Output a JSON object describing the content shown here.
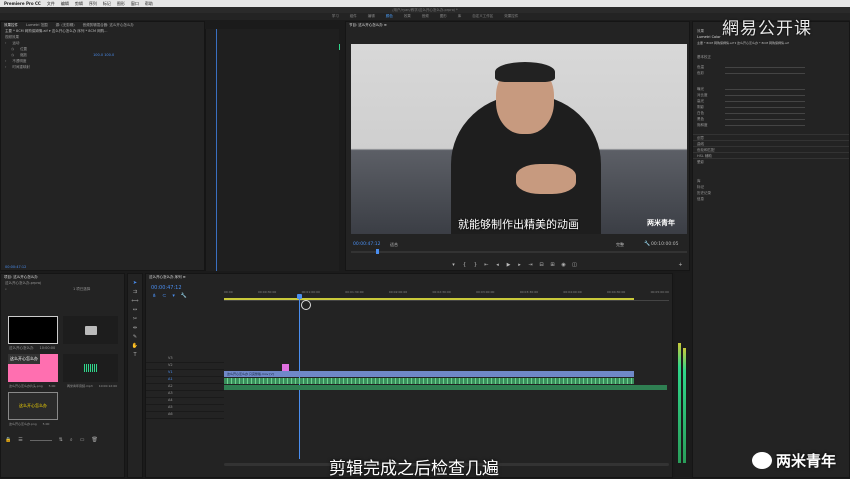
{
  "menubar": {
    "app": "Premiere Pro CC",
    "items": [
      "文件",
      "编辑",
      "剪辑",
      "序列",
      "标记",
      "图形",
      "窗口",
      "帮助"
    ]
  },
  "window_title": "/用户/ryan/教学/这么开心怎么办.prproj *",
  "workspaces": [
    "学习",
    "组件",
    "编辑",
    "颜色",
    "效果",
    "音频",
    "图形",
    "库",
    "自定义工作区",
    "效果控件"
  ],
  "workspace_active": "颜色",
  "left_panel": {
    "tabs": [
      "效果控件",
      "Lumetri 范围",
      "源: (无剪辑)",
      "音频剪辑混合器: 这么开心怎么办"
    ],
    "clip_path": "主要 * 8CM 网购保姆情.aif ▾  这么开心怎么办 序列 * 8CM 网购...",
    "section": "视频效果",
    "rows": [
      {
        "label": "运动",
        "value": ""
      },
      {
        "label": "位置",
        "value": ""
      },
      {
        "label": "缩放",
        "value": "100.0 100.0"
      },
      {
        "label": "不透明度",
        "value": ""
      },
      {
        "label": "时间重映射",
        "value": ""
      }
    ],
    "timecode": "00:00:47:12"
  },
  "effect_clip_label": "8CM 网购保姆情.aif",
  "program_monitor": {
    "title": "节目: 这么开心怎么办 ≡",
    "subtitle": "就能够制作出精美的动画",
    "timecode_in": "00:00:47:12",
    "fit": "适合",
    "quality": "完整",
    "timecode_out": "00:10:00:05",
    "brand_watermark": "两米青年"
  },
  "top_watermark": "網易公开课",
  "project_panel": {
    "title": "项目: 这么开心怎么办",
    "file": "这么开心怎么办.prproj",
    "count": "1 项已选择",
    "items": [
      {
        "name": "这么开心怎么办",
        "dur": "10:00:00"
      },
      {
        "name": "",
        "dur": ""
      },
      {
        "name": "这么开心怎么办片头.png",
        "dur": "5:00"
      },
      {
        "name": "两米青年音频.mp3",
        "dur": "10:00:12:00"
      },
      {
        "name": "这么开心怎么办.png",
        "dur": "5:00"
      }
    ],
    "thumb_text1": "这么开心怎么办",
    "thumb_text2": "这么开心怎么办"
  },
  "timeline": {
    "tab": "这么开心怎么办 序列 ≡",
    "timecode": "00:00:47:12",
    "ruler": [
      "00:00",
      "00:00:30:00",
      "00:01:00:00",
      "00:01:30:00",
      "00:02:00:00",
      "00:02:30:00",
      "00:03:00:00",
      "00:03:30:00",
      "00:04:00:00",
      "00:04:30:00",
      "00:05:00:00"
    ],
    "video_tracks": [
      "V3",
      "V2",
      "V1"
    ],
    "audio_tracks": [
      "A1",
      "A2",
      "A3",
      "A4",
      "A5",
      "A6"
    ],
    "clip_v1_label": "这么开心怎么办 只完整版.mov [V]",
    "big_subtitle": "剪辑完成之后检查几遍"
  },
  "lumetri": {
    "tabs": [
      "效果",
      "Lumetri Color"
    ],
    "path": "主要 * 8CM 网购保姆情.aif ▾ 这么开心怎么办 * 8CM 网购保姆情.aif",
    "sections": [
      "基本校正",
      "创意",
      "曲线",
      "色轮和匹配",
      "HSL 辅助",
      "晕影"
    ],
    "footer": [
      "库",
      "标记",
      "历史记录",
      "信息"
    ],
    "sliders": [
      "色温",
      "色彩",
      "曝光",
      "对比度",
      "高光",
      "阴影",
      "白色",
      "黑色",
      "饱和度"
    ]
  },
  "colors": {
    "accent": "#4a8ef0",
    "green_clip": "#2fd68a",
    "video_clip": "#6f88c8",
    "audio_clip": "#3a8f5c"
  },
  "wechat_brand": "两米青年"
}
